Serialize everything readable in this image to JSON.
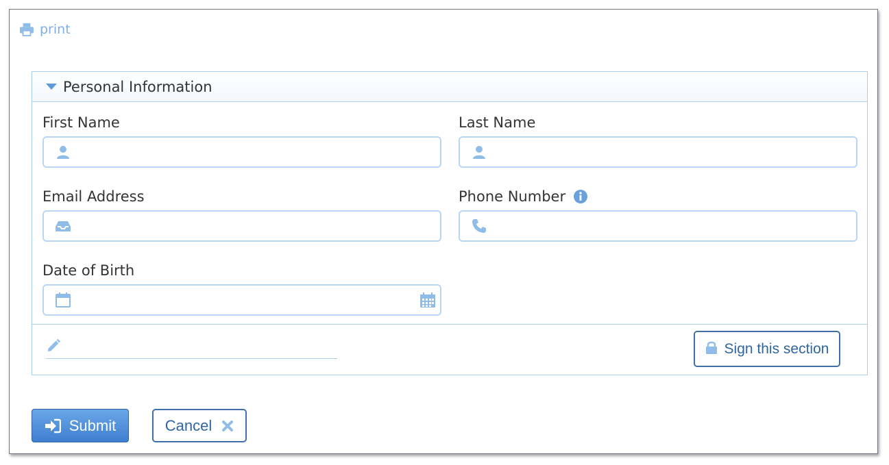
{
  "toolbar": {
    "print_label": "print"
  },
  "section": {
    "title": "Personal Information",
    "fields": {
      "first_name": {
        "label": "First Name",
        "value": "",
        "icon": "user-icon"
      },
      "last_name": {
        "label": "Last Name",
        "value": "",
        "icon": "user-icon"
      },
      "email": {
        "label": "Email Address",
        "value": "",
        "icon": "inbox-icon"
      },
      "phone": {
        "label": "Phone Number",
        "value": "",
        "icon": "phone-icon",
        "help_icon": "info-icon"
      },
      "dob": {
        "label": "Date of Birth",
        "value": "",
        "icon": "calendar-icon",
        "trail_icon": "calendar-grid-icon"
      }
    },
    "signature": {
      "button_label": "Sign this section",
      "icon": "lock-icon"
    }
  },
  "actions": {
    "submit_label": "Submit",
    "cancel_label": "Cancel"
  },
  "colors": {
    "accent": "#3f7fd0",
    "border": "#a9cdef",
    "icon": "#8fbde8",
    "text": "#333333"
  }
}
